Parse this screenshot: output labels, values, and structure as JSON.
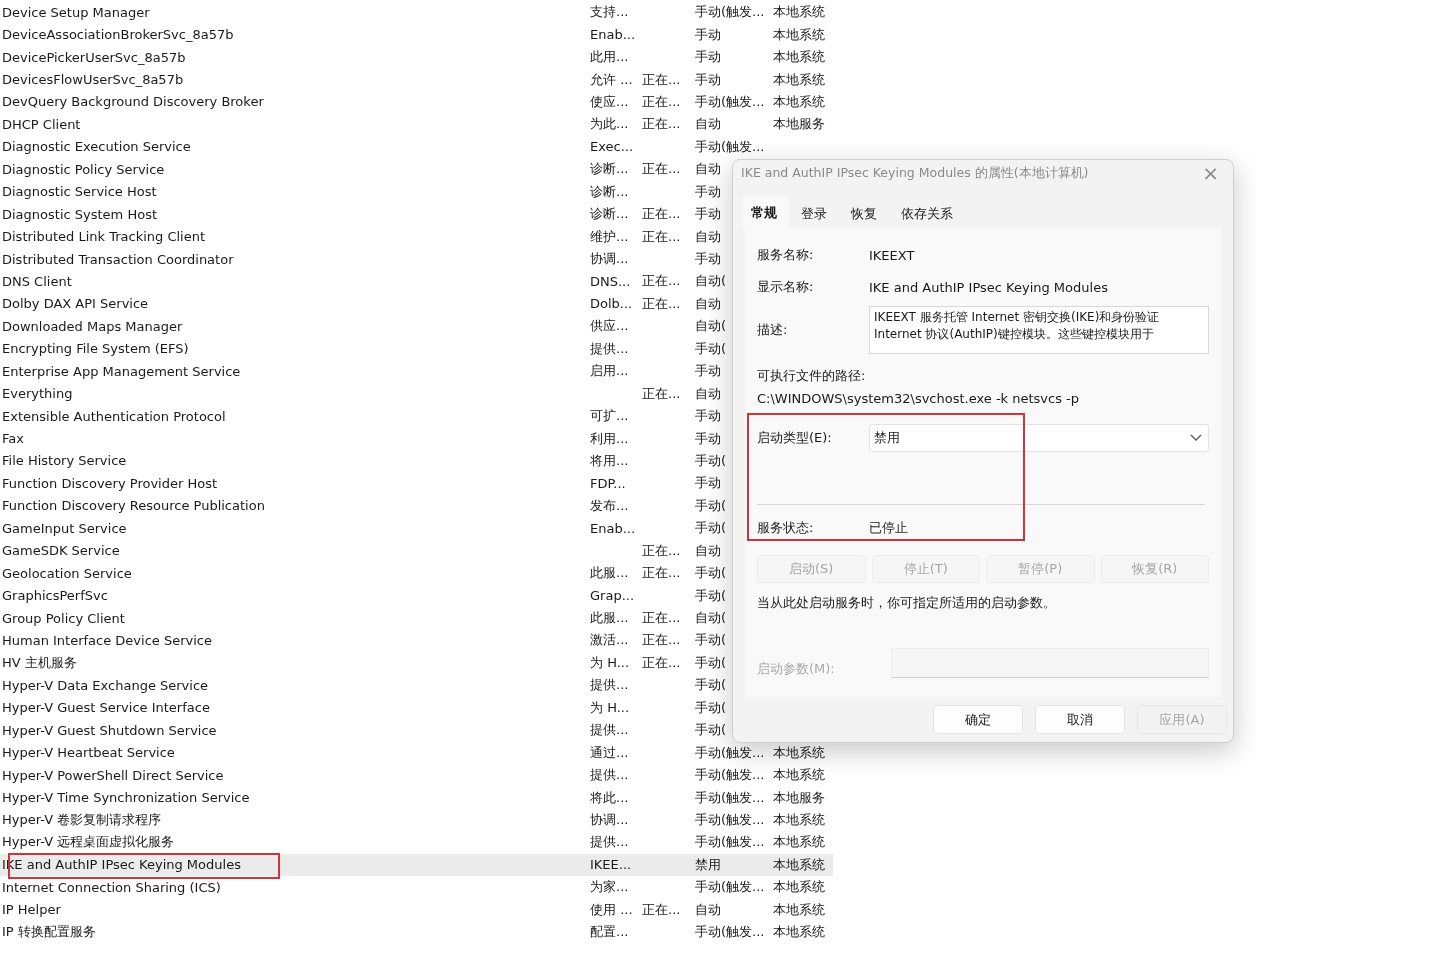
{
  "services": [
    {
      "name": "Device Setup Manager",
      "description": "支持...",
      "startup": "手动(触发...",
      "logon": "本地系统",
      "selected": false,
      "marked": false
    },
    {
      "name": "DeviceAssociationBrokerSvc_8a57b",
      "description": "Enab...",
      "startup": "手动",
      "logon": "本地系统",
      "selected": false,
      "marked": false
    },
    {
      "name": "DevicePickerUserSvc_8a57b",
      "description": "此用...",
      "startup": "手动",
      "logon": "本地系统",
      "selected": false,
      "marked": false
    },
    {
      "name": "DevicesFlowUserSvc_8a57b",
      "description": "允许 ...",
      "status": "正在...",
      "startup": "手动",
      "logon": "本地系统",
      "selected": false,
      "marked": false
    },
    {
      "name": "DevQuery Background Discovery Broker",
      "description": "使应...",
      "status": "正在...",
      "startup": "手动(触发...",
      "logon": "本地系统",
      "selected": false,
      "marked": false
    },
    {
      "name": "DHCP Client",
      "description": "为此...",
      "status": "正在...",
      "startup": "自动",
      "logon": "本地服务",
      "selected": false,
      "marked": false
    },
    {
      "name": "Diagnostic Execution Service",
      "description": "Exec...",
      "startup": "手动(触发...",
      "selected": false,
      "marked": false
    },
    {
      "name": "Diagnostic Policy Service",
      "description": "诊断...",
      "status": "正在...",
      "startup": "自动",
      "selected": false,
      "marked": false
    },
    {
      "name": "Diagnostic Service Host",
      "description": "诊断...",
      "startup": "手动",
      "selected": false,
      "marked": false
    },
    {
      "name": "Diagnostic System Host",
      "description": "诊断...",
      "status": "正在...",
      "startup": "手动",
      "selected": false,
      "marked": false
    },
    {
      "name": "Distributed Link Tracking Client",
      "description": "维护...",
      "status": "正在...",
      "startup": "自动",
      "selected": false,
      "marked": false
    },
    {
      "name": "Distributed Transaction Coordinator",
      "description": "协调...",
      "startup": "手动",
      "selected": false,
      "marked": false
    },
    {
      "name": "DNS Client",
      "description": "DNS...",
      "status": "正在...",
      "startup": "自动(",
      "selected": false,
      "marked": false
    },
    {
      "name": "Dolby DAX API Service",
      "description": "Dolb...",
      "status": "正在...",
      "startup": "自动",
      "selected": false,
      "marked": false
    },
    {
      "name": "Downloaded Maps Manager",
      "description": "供应...",
      "startup": "自动(",
      "selected": false,
      "marked": false
    },
    {
      "name": "Encrypting File System (EFS)",
      "description": "提供...",
      "startup": "手动(",
      "selected": false,
      "marked": false
    },
    {
      "name": "Enterprise App Management Service",
      "description": "启用...",
      "startup": "手动",
      "selected": false,
      "marked": false
    },
    {
      "name": "Everything",
      "status": "正在...",
      "startup": "自动",
      "selected": false,
      "marked": false
    },
    {
      "name": "Extensible Authentication Protocol",
      "description": "可扩...",
      "startup": "手动",
      "selected": false,
      "marked": false
    },
    {
      "name": "Fax",
      "description": "利用...",
      "startup": "手动",
      "selected": false,
      "marked": false
    },
    {
      "name": "File History Service",
      "description": "将用...",
      "startup": "手动(",
      "selected": false,
      "marked": false
    },
    {
      "name": "Function Discovery Provider Host",
      "description": "FDP...",
      "startup": "手动",
      "selected": false,
      "marked": false
    },
    {
      "name": "Function Discovery Resource Publication",
      "description": "发布...",
      "startup": "手动(",
      "selected": false,
      "marked": false
    },
    {
      "name": "GameInput Service",
      "description": "Enab...",
      "startup": "手动(",
      "selected": false,
      "marked": false
    },
    {
      "name": "GameSDK Service",
      "status": "正在...",
      "startup": "自动",
      "selected": false,
      "marked": false
    },
    {
      "name": "Geolocation Service",
      "description": "此服...",
      "status": "正在...",
      "startup": "手动(",
      "selected": false,
      "marked": false
    },
    {
      "name": "GraphicsPerfSvc",
      "description": "Grap...",
      "startup": "手动(",
      "selected": false,
      "marked": false
    },
    {
      "name": "Group Policy Client",
      "description": "此服...",
      "status": "正在...",
      "startup": "自动(",
      "selected": false,
      "marked": false
    },
    {
      "name": "Human Interface Device Service",
      "description": "激活...",
      "status": "正在...",
      "startup": "手动(",
      "selected": false,
      "marked": false
    },
    {
      "name": "HV 主机服务",
      "description": "为 H...",
      "status": "正在...",
      "startup": "手动(",
      "selected": false,
      "marked": false
    },
    {
      "name": "Hyper-V Data Exchange Service",
      "description": "提供...",
      "startup": "手动(",
      "selected": false,
      "marked": false
    },
    {
      "name": "Hyper-V Guest Service Interface",
      "description": "为 H...",
      "startup": "手动(",
      "selected": false,
      "marked": false
    },
    {
      "name": "Hyper-V Guest Shutdown Service",
      "description": "提供...",
      "startup": "手动(",
      "selected": false,
      "marked": false
    },
    {
      "name": "Hyper-V Heartbeat Service",
      "description": "通过...",
      "startup": "手动(触发...",
      "logon": "本地系统",
      "selected": false,
      "marked": false
    },
    {
      "name": "Hyper-V PowerShell Direct Service",
      "description": "提供...",
      "startup": "手动(触发...",
      "logon": "本地系统",
      "selected": false,
      "marked": false
    },
    {
      "name": "Hyper-V Time Synchronization Service",
      "description": "将此...",
      "startup": "手动(触发...",
      "logon": "本地服务",
      "selected": false,
      "marked": false
    },
    {
      "name": "Hyper-V 卷影复制请求程序",
      "description": "协调...",
      "startup": "手动(触发...",
      "logon": "本地系统",
      "selected": false,
      "marked": false
    },
    {
      "name": "Hyper-V 远程桌面虚拟化服务",
      "description": "提供...",
      "startup": "手动(触发...",
      "logon": "本地系统",
      "selected": false,
      "marked": false
    },
    {
      "name": "IKE and AuthIP IPsec Keying Modules",
      "description": "IKEE...",
      "startup": "禁用",
      "logon": "本地系统",
      "selected": true,
      "marked": true
    },
    {
      "name": "Internet Connection Sharing (ICS)",
      "description": "为家...",
      "startup": "手动(触发...",
      "logon": "本地系统",
      "selected": false,
      "marked": false
    },
    {
      "name": "IP Helper",
      "description": "使用 ...",
      "status": "正在...",
      "startup": "自动",
      "logon": "本地系统",
      "selected": false,
      "marked": false
    },
    {
      "name": "IP 转换配置服务",
      "description": "配置...",
      "startup": "手动(触发...",
      "logon": "本地系统",
      "selected": false,
      "marked": false
    }
  ],
  "dialog": {
    "title": "IKE and AuthIP IPsec Keying Modules 的属性(本地计算机)",
    "close": "×",
    "tabs": [
      {
        "label": "常规",
        "selected": true
      },
      {
        "label": "登录",
        "selected": false
      },
      {
        "label": "恢复",
        "selected": false
      },
      {
        "label": "依存关系",
        "selected": false
      }
    ],
    "service_name": {
      "label": "服务名称:",
      "value": "IKEEXT"
    },
    "display_name": {
      "label": "显示名称:",
      "value": "IKE and AuthIP IPsec Keying Modules"
    },
    "description": {
      "label": "描述:",
      "lines": [
        "IKEEXT 服务托管 Internet 密钥交换(IKE)和身份验证",
        "Internet 协议(AuthIP)键控模块。这些键控模块用于"
      ]
    },
    "path": {
      "label": "可执行文件的路径:",
      "value": "C:\\WINDOWS\\system32\\svchost.exe -k netsvcs -p"
    },
    "startup_type": {
      "label": "启动类型(E):",
      "value": "禁用"
    },
    "service_status": {
      "label": "服务状态:",
      "value": "已停止"
    },
    "marked_section": true,
    "control_buttons": [
      {
        "label": "启动(S)",
        "disabled": true
      },
      {
        "label": "停止(T)",
        "disabled": true
      },
      {
        "label": "暂停(P)",
        "disabled": true
      },
      {
        "label": "恢复(R)",
        "disabled": true
      }
    ],
    "note": "当从此处启动服务时，你可指定所适用的启动参数。",
    "start_params": {
      "label": "启动参数(M):",
      "disabled": true
    },
    "footer_buttons": [
      {
        "label": "确定",
        "disabled": false
      },
      {
        "label": "取消",
        "disabled": false
      },
      {
        "label": "应用(A)",
        "disabled": true
      }
    ]
  }
}
